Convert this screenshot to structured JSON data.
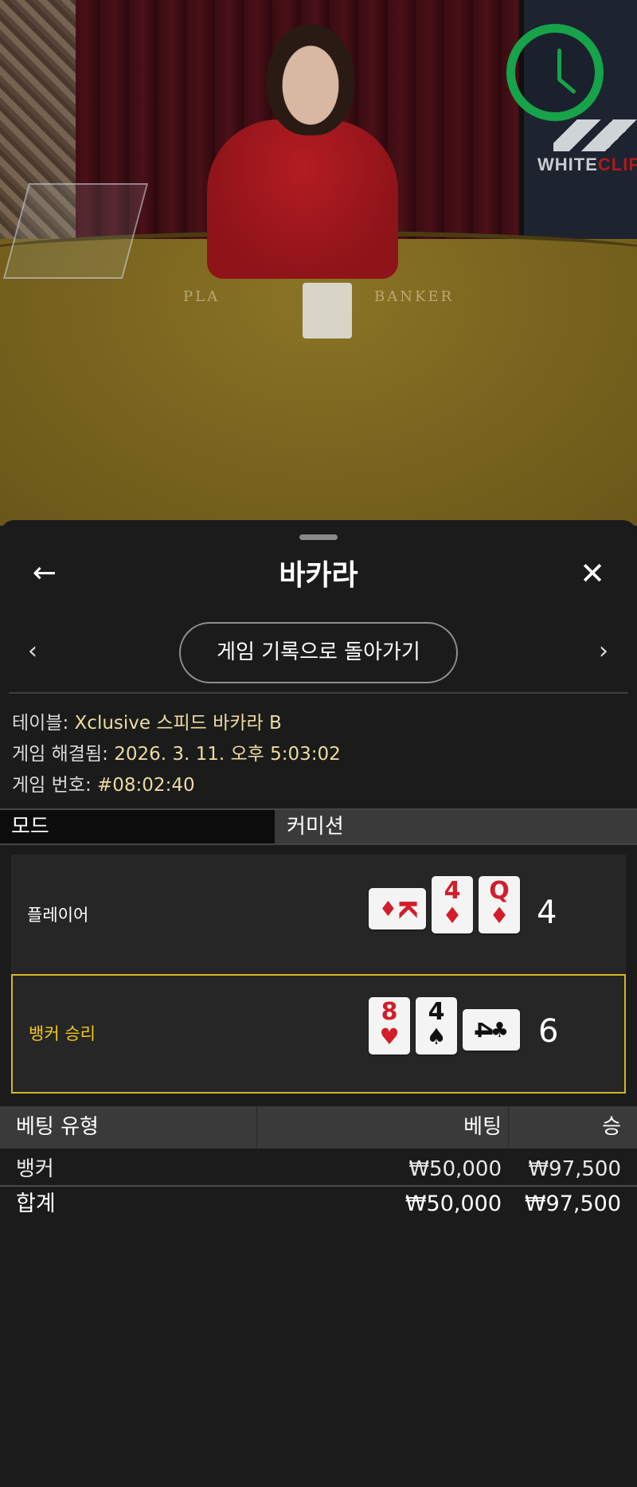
{
  "video": {
    "brand": {
      "white": "WHITE",
      "cliff": "CLIFF"
    },
    "felt_left": "PLA",
    "felt_right": "BANKER",
    "timer_icon": "clock-icon",
    "accent_green": "#16a34a"
  },
  "header": {
    "title": "바카라",
    "back_icon": "arrow-left-icon",
    "close_icon": "close-icon"
  },
  "nav": {
    "prev_icon": "chevron-left-icon",
    "next_icon": "chevron-right-icon",
    "history_button": "게임 기록으로 돌아가기"
  },
  "info": {
    "table_label": "테이블:",
    "table_value": "Xclusive 스피드 바카라 B",
    "resolved_label": "게임 해결됨:",
    "resolved_value": "2026. 3. 11. 오후 5:03:02",
    "number_label": "게임 번호:",
    "number_value": "#08:02:40"
  },
  "tabs": {
    "mode": "모드",
    "commission": "커미션"
  },
  "hands": {
    "player": {
      "label": "플레이어",
      "score": "4",
      "cards": [
        {
          "rank": "K",
          "suit": "♦",
          "color": "#d11e2b",
          "orientation": "sideways"
        },
        {
          "rank": "4",
          "suit": "♦",
          "color": "#d11e2b"
        },
        {
          "rank": "Q",
          "suit": "♦",
          "color": "#d11e2b"
        }
      ]
    },
    "banker": {
      "label": "뱅커 승리",
      "score": "6",
      "highlight_color": "#d4b52a",
      "cards": [
        {
          "rank": "8",
          "suit": "♥",
          "color": "#d11e2b"
        },
        {
          "rank": "4",
          "suit": "♠",
          "color": "#111111"
        },
        {
          "rank": "4",
          "suit": "♣",
          "color": "#111111",
          "orientation": "sideways"
        }
      ]
    }
  },
  "bets": {
    "headers": {
      "type": "베팅 유형",
      "bet": "베팅",
      "win": "승"
    },
    "rows": [
      {
        "type": "뱅커",
        "bet": "₩50,000",
        "win": "₩97,500"
      }
    ],
    "total": {
      "label": "합계",
      "bet": "₩50,000",
      "win": "₩97,500"
    }
  }
}
